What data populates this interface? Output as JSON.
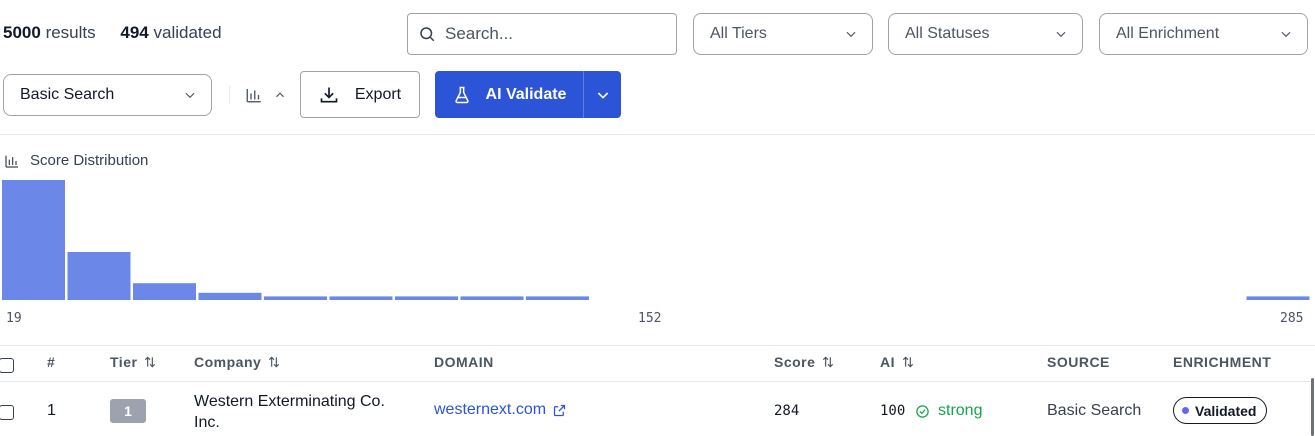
{
  "summary": {
    "results_count": "5000",
    "results_label": "results",
    "validated_count": "494",
    "validated_label": "validated"
  },
  "search": {
    "placeholder": "Search...",
    "icon": "search-icon"
  },
  "filters": {
    "tier": "All Tiers",
    "status": "All Statuses",
    "enrichment": "All Enrichment"
  },
  "toolbar": {
    "search_mode": "Basic Search",
    "export_label": "Export",
    "ai_validate_label": "AI Validate"
  },
  "distribution": {
    "title": "Score Distribution",
    "axis_min_label": "19",
    "axis_mid_label": "152",
    "axis_max_label": "285"
  },
  "chart_data": {
    "type": "bar",
    "title": "Score Distribution",
    "x_range": [
      19,
      285
    ],
    "bin_count": 20,
    "values": [
      100,
      40,
      14,
      6,
      3,
      3,
      3,
      3,
      3,
      0,
      0,
      0,
      0,
      0,
      0,
      0,
      0,
      0,
      0,
      3
    ],
    "color": "#6b88e8"
  },
  "table": {
    "columns": {
      "num": "#",
      "tier": "Tier",
      "company": "Company",
      "domain": "DOMAIN",
      "score": "Score",
      "ai": "AI",
      "source": "SOURCE",
      "enrichment": "ENRICHMENT"
    },
    "rows": [
      {
        "num": "1",
        "tier": "1",
        "company": "Western Exterminating Co. Inc.",
        "domain": "westernext.com",
        "score": "284",
        "ai_score": "100",
        "ai_label": "strong",
        "source": "Basic Search",
        "enrichment": "Validated"
      }
    ]
  },
  "colors": {
    "accent": "#2c54d6",
    "bar": "#6b88e8",
    "success": "#16a34a",
    "badge_dot": "#6366f1"
  }
}
